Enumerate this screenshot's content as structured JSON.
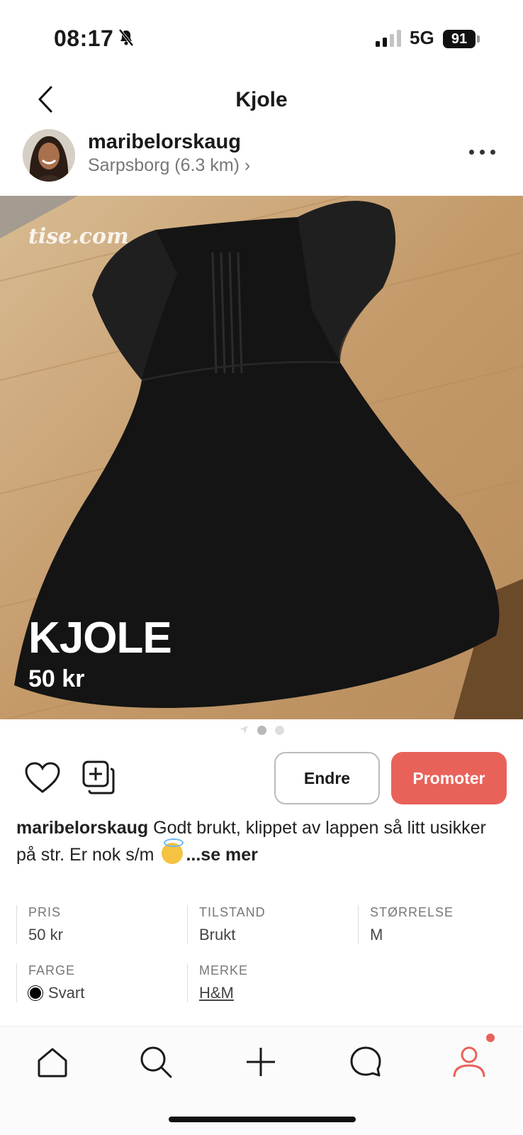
{
  "status_bar": {
    "time": "08:17",
    "network": "5G",
    "battery": "91"
  },
  "header": {
    "title": "Kjole"
  },
  "seller": {
    "username": "maribelorskaug",
    "location": "Sarpsborg (6.3 km) ›"
  },
  "hero": {
    "watermark": "tise.com",
    "title": "KJOLE",
    "price": "50 kr"
  },
  "pagination": {
    "count": 2,
    "active_index": 0
  },
  "actions": {
    "edit_label": "Endre",
    "promote_label": "Promoter"
  },
  "description": {
    "username": "maribelorskaug",
    "text": " Godt brukt, klippet av lappen så litt usikker på str. Er nok s/m ",
    "more": "...se mer"
  },
  "details": {
    "price": {
      "label": "PRIS",
      "value": "50 kr"
    },
    "condition": {
      "label": "TILSTAND",
      "value": "Brukt"
    },
    "size": {
      "label": "STØRRELSE",
      "value": "M"
    },
    "color": {
      "label": "FARGE",
      "value": "Svart",
      "swatch": "#000000"
    },
    "brand": {
      "label": "MERKE",
      "value": "H&M"
    }
  },
  "colors": {
    "accent": "#e8625a"
  }
}
